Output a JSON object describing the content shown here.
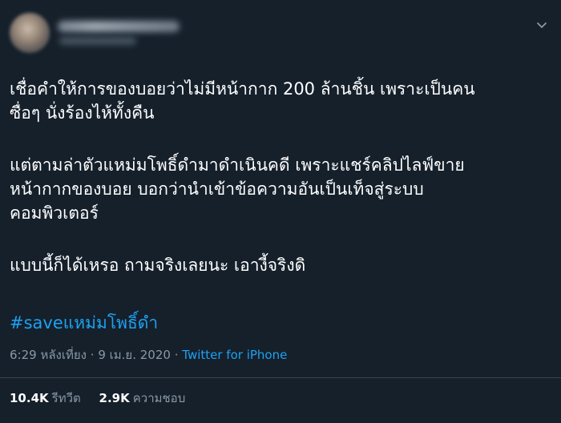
{
  "tweet": {
    "lines": [
      "เชื่อคำให้การของบอยว่าไม่มีหน้ากาก 200 ล้านชิ้น เพราะเป็นคน",
      "ซื่อๆ นั่งร้องไห้ทั้งคืน",
      "แต่ตามล่าตัวแหม่มโพธิ์ดำมาดำเนินคดี เพราะแชร์คลิปไลฟ์ขาย",
      "หน้ากากของบอย บอกว่านำเข้าข้อความอันเป็นเท็จสู่ระบบ",
      "คอมพิวเตอร์",
      "แบบนี้ก็ได้เหรอ ถามจริงเลยนะ เอางี้จริงดิ"
    ],
    "hashtag": "#saveแหม่มโพธิ์ดำ",
    "time": "6:29 หลังเที่ยง",
    "separator": "·",
    "date": "9 เม.ย. 2020",
    "source": "Twitter for iPhone",
    "retweets_count": "10.4K",
    "retweets_label": "รีทวีต",
    "likes_count": "2.9K",
    "likes_label": "ความชอบ"
  },
  "icons": {
    "caret": "chevron-down-icon"
  },
  "colors": {
    "background": "#15202b",
    "text": "#ffffff",
    "secondary_text": "#8899a6",
    "link": "#1da1f2",
    "divider": "#38444d"
  }
}
